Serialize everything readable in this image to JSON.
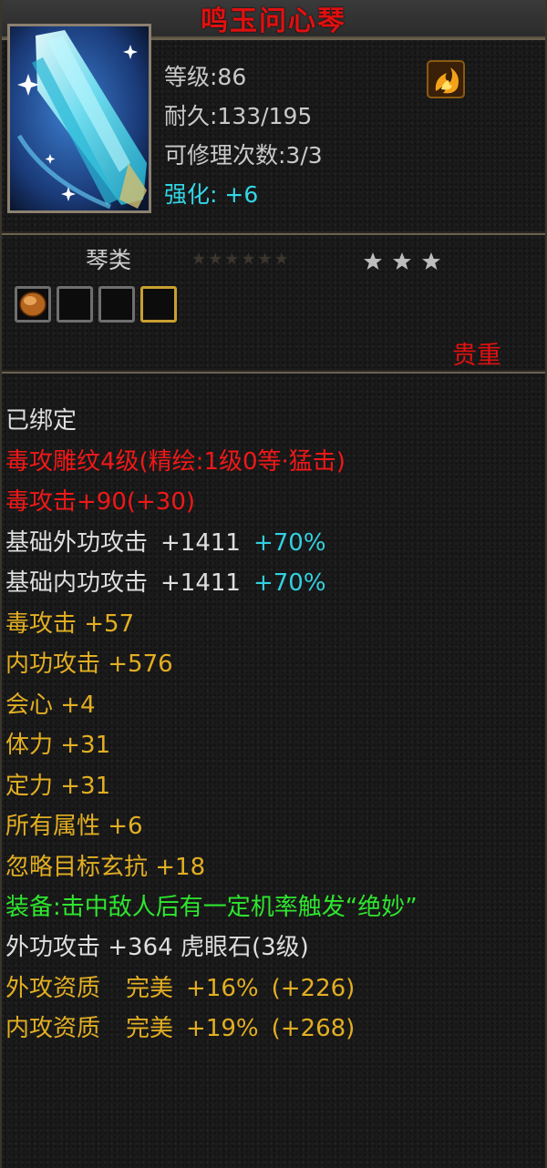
{
  "item": {
    "name": "鸣玉问心琴",
    "level_label": "等级:86",
    "durability_label": "耐久:133/195",
    "repair_label": "可修理次数:3/3",
    "enhance_label": "强化:",
    "enhance_value": "+6",
    "category": "琴类",
    "rarity": "贵重",
    "stars": 3,
    "sockets": [
      {
        "state": "filled",
        "gem": "amber-gem-icon"
      },
      {
        "state": "empty"
      },
      {
        "state": "empty"
      },
      {
        "state": "empty-gold"
      }
    ]
  },
  "attributes": {
    "bound": "已绑定",
    "engrave": "毒攻雕纹4级(精绘:1级0等·猛击)",
    "poison_attack_engrave": "毒攻击+90(+30)",
    "outer_base_label": "基础外功攻击",
    "outer_base_value": "+1411",
    "outer_base_pct": "+70%",
    "inner_base_label": "基础内功攻击",
    "inner_base_value": "+1411",
    "inner_base_pct": "+70%",
    "poison_attack": "毒攻击 +57",
    "inner_attack": "内功攻击 +576",
    "crit": "会心 +4",
    "stamina": "体力 +31",
    "focus": "定力 +31",
    "all_attr": "所有属性 +6",
    "ignore_res": "忽略目标玄抗 +18",
    "equip_effect": "装备:击中敌人后有一定机率触发“绝妙”",
    "gem_line": "外功攻击 +364 虎眼石(3级)",
    "outer_quality_label": "外攻资质",
    "outer_quality_grade": "完美",
    "outer_quality_value": "+16%",
    "outer_quality_bonus": "(+226)",
    "inner_quality_label": "内攻资质",
    "inner_quality_grade": "完美",
    "inner_quality_value": "+19%",
    "inner_quality_bonus": "(+268)"
  },
  "colors": {
    "name": "#e01010",
    "enhance": "#33d6e6",
    "gold": "#e2ae22",
    "green": "#2ee62e",
    "red": "#f01818"
  }
}
